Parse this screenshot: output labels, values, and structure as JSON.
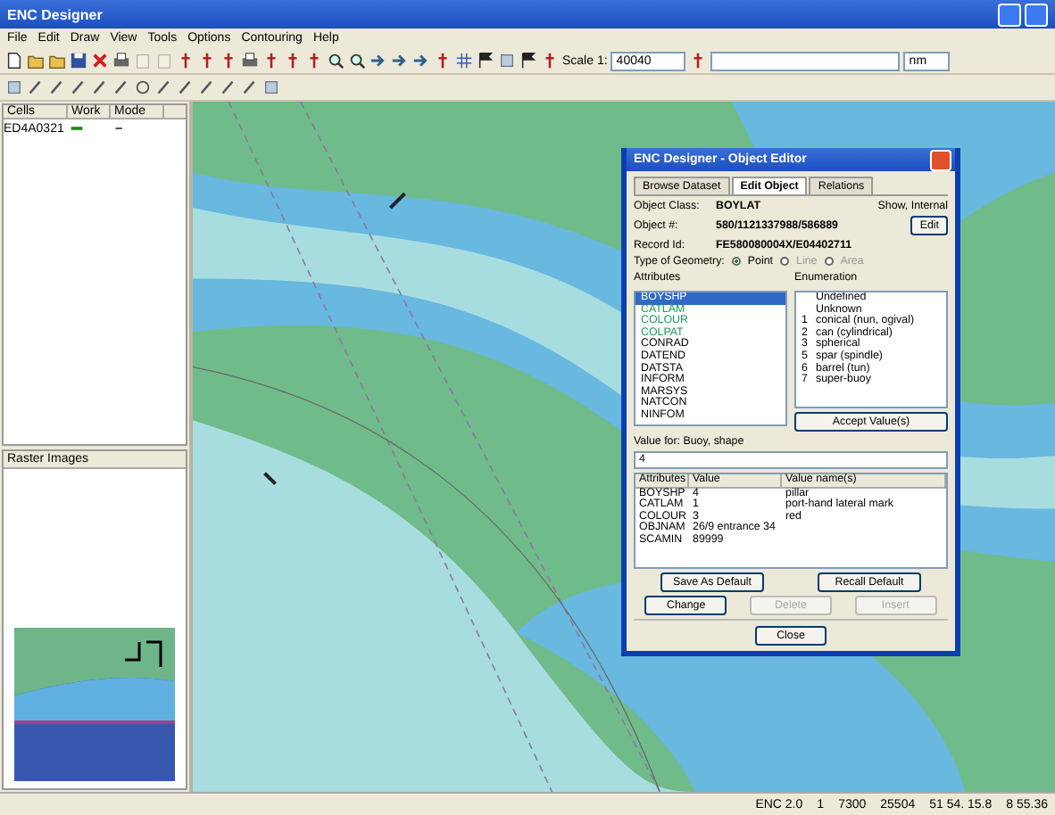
{
  "window": {
    "title": "ENC Designer"
  },
  "menu": [
    "File",
    "Edit",
    "Draw",
    "View",
    "Tools",
    "Options",
    "Contouring",
    "Help"
  ],
  "scale": {
    "label": "Scale 1:",
    "value": "40040",
    "unit": "nm"
  },
  "cells_panel": {
    "columns": [
      "Cells",
      "Work",
      "Mode"
    ],
    "rows": [
      {
        "cell": "ED4A0321"
      }
    ]
  },
  "raster_panel": {
    "title": "Raster Images"
  },
  "dialog": {
    "title": "ENC Designer - Object Editor",
    "tabs": [
      {
        "label": "Browse Dataset",
        "selected": false
      },
      {
        "label": "Edit Object",
        "selected": true
      },
      {
        "label": "Relations",
        "selected": false
      }
    ],
    "object_class": {
      "label": "Object Class:",
      "value": "BOYLAT",
      "side": "Show, Internal"
    },
    "object_number": {
      "label": "Object #:",
      "value": "580/1121337988/586889",
      "button": "Edit"
    },
    "record_id": {
      "label": "Record Id:",
      "value": "FE580080004X/E04402711"
    },
    "geometry": {
      "label": "Type of Geometry:",
      "options": [
        {
          "label": "Point",
          "selected": true,
          "disabled": false
        },
        {
          "label": "Line",
          "selected": false,
          "disabled": true
        },
        {
          "label": "Area",
          "selected": false,
          "disabled": true
        }
      ]
    },
    "attributes": {
      "label": "Attributes",
      "items": [
        {
          "code": "BOYSHP",
          "set": true,
          "selected": true
        },
        {
          "code": "CATLAM",
          "set": true,
          "selected": false
        },
        {
          "code": "COLOUR",
          "set": true,
          "selected": false
        },
        {
          "code": "COLPAT",
          "set": true,
          "selected": false
        },
        {
          "code": "CONRAD",
          "set": false,
          "selected": false
        },
        {
          "code": "DATEND",
          "set": false,
          "selected": false
        },
        {
          "code": "DATSTA",
          "set": false,
          "selected": false
        },
        {
          "code": "INFORM",
          "set": false,
          "selected": false
        },
        {
          "code": "MARSYS",
          "set": false,
          "selected": false
        },
        {
          "code": "NATCON",
          "set": false,
          "selected": false
        },
        {
          "code": "NINFOM",
          "set": false,
          "selected": false
        }
      ]
    },
    "enumeration": {
      "label": "Enumeration",
      "items": [
        {
          "text": "Undefined"
        },
        {
          "text": "Unknown"
        },
        {
          "num": "1",
          "text": "conical (nun, ogival)"
        },
        {
          "num": "2",
          "text": "can (cylindrical)"
        },
        {
          "num": "3",
          "text": "spherical"
        },
        {
          "num": "5",
          "text": "spar (spindle)"
        },
        {
          "num": "6",
          "text": "barrel (tun)"
        },
        {
          "num": "7",
          "text": "super-buoy"
        }
      ],
      "button": "Accept Value(s)"
    },
    "value_for": {
      "label": "Value for: Buoy, shape",
      "value": "4"
    },
    "table": {
      "columns": [
        "Attributes",
        "Value",
        "Value name(s)"
      ],
      "rows": [
        [
          "BOYSHP",
          "4",
          "pillar"
        ],
        [
          "CATLAM",
          "1",
          "port-hand lateral mark"
        ],
        [
          "COLOUR",
          "3",
          "red"
        ],
        [
          "OBJNAM",
          "26/9 entrance 34",
          ""
        ],
        [
          "SCAMIN",
          "89999",
          ""
        ]
      ]
    },
    "buttons": [
      {
        "label": "Save As Default",
        "disabled": false
      },
      {
        "label": "Recall Default",
        "disabled": false
      },
      {
        "label": "Change",
        "disabled": false
      },
      {
        "label": "Delete",
        "disabled": true
      },
      {
        "label": "Insert",
        "disabled": true
      }
    ],
    "close": "Close"
  },
  "status_bar": [
    "ENC 2.0",
    "1",
    "7300",
    "25504",
    "51 54. 15.8",
    "8 55.36"
  ]
}
